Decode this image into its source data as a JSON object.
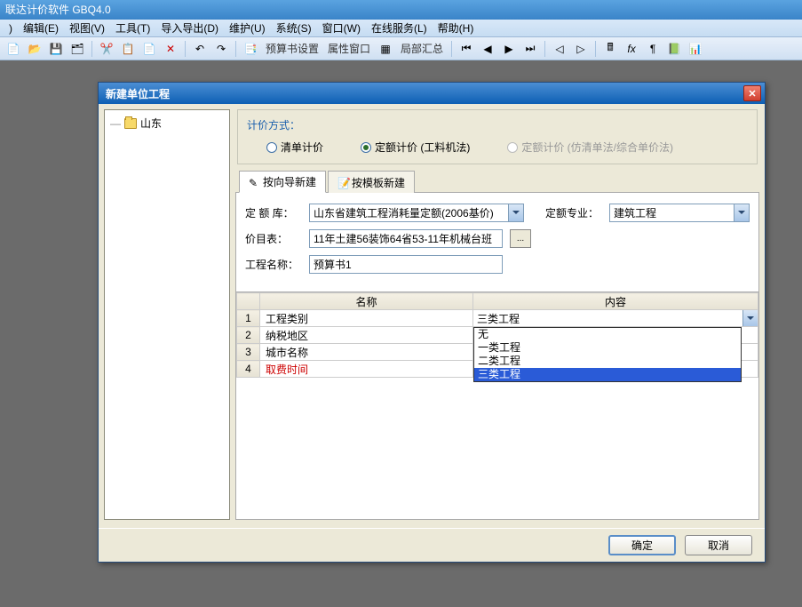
{
  "app": {
    "title": "联达计价软件  GBQ4.0"
  },
  "menus": [
    "编辑(E)",
    "视图(V)",
    "工具(T)",
    "导入导出(D)",
    "维护(U)",
    "系统(S)",
    "窗口(W)",
    "在线服务(L)",
    "帮助(H)"
  ],
  "toolbar": {
    "budgetSettings": "预算书设置",
    "propWindow": "属性窗口",
    "localSummary": "局部汇总"
  },
  "dialog": {
    "title": "新建单位工程",
    "treeRoot": "山东",
    "methodLegend": "计价方式：",
    "methods": {
      "m1": "清单计价",
      "m2": "定额计价 (工料机法)",
      "m3": "定额计价 (仿清单法/综合单价法)"
    },
    "tabs": {
      "wizard": "按向导新建",
      "template": "按模板新建"
    },
    "form": {
      "quotaLibLabel": "定 额 库：",
      "quotaLibValue": "山东省建筑工程消耗量定额(2006基价)",
      "quotaProfLabel": "定额专业：",
      "quotaProfValue": "建筑工程",
      "priceListLabel": "价目表：",
      "priceListValue": "11年土建56装饰64省53-11年机械台班",
      "browse": "...",
      "projNameLabel": "工程名称：",
      "projNameValue": "预算书1"
    },
    "grid": {
      "headers": {
        "name": "名称",
        "content": "内容"
      },
      "rows": [
        {
          "num": "1",
          "name": "工程类别",
          "content": "三类工程",
          "hasCombo": true
        },
        {
          "num": "2",
          "name": "纳税地区",
          "content": ""
        },
        {
          "num": "3",
          "name": "城市名称",
          "content": ""
        },
        {
          "num": "4",
          "name": "取费时间",
          "content": "",
          "red": true
        }
      ],
      "dropdown": [
        "无",
        "一类工程",
        "二类工程",
        "三类工程"
      ]
    },
    "buttons": {
      "ok": "确定",
      "cancel": "取消"
    }
  }
}
